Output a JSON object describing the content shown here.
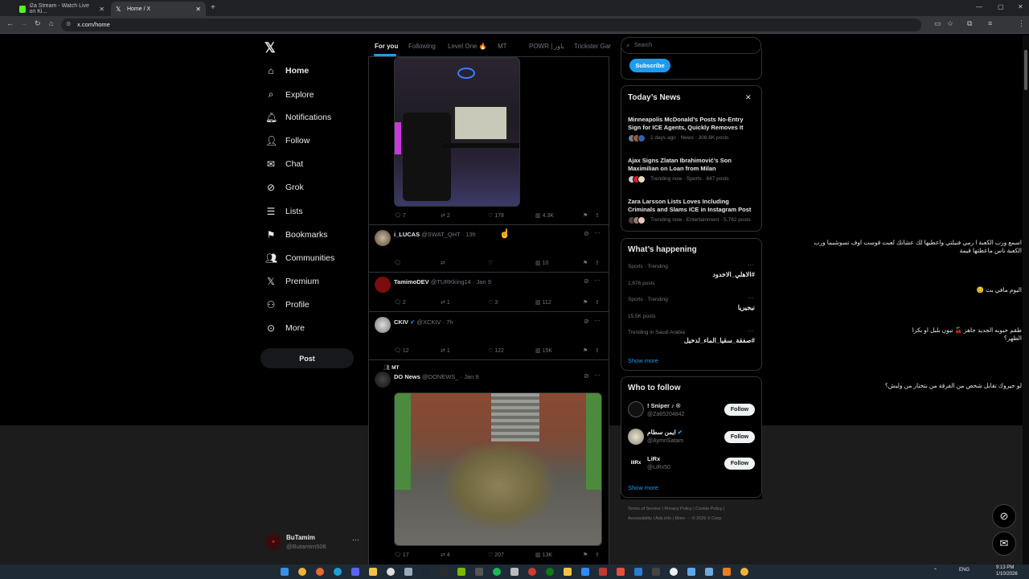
{
  "browser": {
    "tabs": [
      {
        "title": "i2a Stream - Watch Live on Ki...",
        "favicon_color": "#53fc18"
      },
      {
        "title": "Home / X",
        "favicon_color": "#ffffff"
      }
    ],
    "url": "x.com/home"
  },
  "sidebar": {
    "logo": "𝕏",
    "items": [
      {
        "label": "Home",
        "icon": "home-icon",
        "glyph": "⌂"
      },
      {
        "label": "Explore",
        "icon": "search-icon",
        "glyph": "⌕"
      },
      {
        "label": "Notifications",
        "icon": "bell-icon",
        "glyph": "🔔︎"
      },
      {
        "label": "Follow",
        "icon": "person-add-icon",
        "glyph": "👤︎"
      },
      {
        "label": "Chat",
        "icon": "envelope-icon",
        "glyph": "✉"
      },
      {
        "label": "Grok",
        "icon": "grok-icon",
        "glyph": "⊘"
      },
      {
        "label": "Lists",
        "icon": "list-icon",
        "glyph": "☰"
      },
      {
        "label": "Bookmarks",
        "icon": "bookmark-icon",
        "glyph": "⚑"
      },
      {
        "label": "Communities",
        "icon": "communities-icon",
        "glyph": "👥︎"
      },
      {
        "label": "Premium",
        "icon": "x-premium-icon",
        "glyph": "𝕏"
      },
      {
        "label": "Profile",
        "icon": "profile-icon",
        "glyph": "⚇"
      },
      {
        "label": "More",
        "icon": "more-circle-icon",
        "glyph": "⊙"
      }
    ],
    "post_label": "Post",
    "account": {
      "name": "BuTamim",
      "handle": "@Butamim506",
      "more": "···"
    }
  },
  "timeline": {
    "tabs": [
      "For you",
      "Following",
      "Level One 🔥",
      "MT",
      "POWR | باور",
      "Trickster Gar"
    ],
    "tweets": [
      {
        "actions": {
          "replies": "7",
          "reposts": "2",
          "likes": "178",
          "views": "4.3K"
        }
      },
      {
        "name": "i_LUCAS",
        "handle": "@SWAT_QHT",
        "time": "· 13h",
        "text": "اسمع ورب الكعبة ا رمي فنيلتي واعطيها لك عشانك لعبت قوست اوف تسوشيما ورب الكعبة ناس ماعطتها قيمة",
        "actions": {
          "replies": "",
          "reposts": "",
          "likes": "",
          "views": "10"
        }
      },
      {
        "name": "TamimoDEV",
        "handle": "@TURKking14",
        "time": "· Jan 9",
        "text": "اليوم مافي بث 😊",
        "actions": {
          "replies": "2",
          "reposts": "1",
          "likes": "3",
          "views": "112"
        }
      },
      {
        "name": "CKIV",
        "handle": "@XCKIV",
        "time": "· 7h",
        "text": "طقم حبوبه الجديد جاهز 🍒 تبون بلبل او بكرا الظهر؟",
        "actions": {
          "replies": "12",
          "reposts": "1",
          "likes": "122",
          "views": "15K"
        }
      },
      {
        "community": "MT",
        "name": "DO News",
        "handle": "@DONEWS_",
        "time": "· Jan 9",
        "text": "لو حيروك تقابل شخص من الفرقة من بتختار من وليش؟",
        "actions": {
          "replies": "17",
          "reposts": "4",
          "likes": "207",
          "views": "13K"
        }
      }
    ]
  },
  "right": {
    "search_placeholder": "Search",
    "subscribe_label": "Subscribe",
    "news_title": "Today’s News",
    "news": [
      {
        "headline": "Minneapolis McDonald’s Posts No-Entry Sign for ICE Agents, Quickly Removes It",
        "meta": "2 days ago · News · 308.6K posts"
      },
      {
        "headline": "Ajax Signs Zlatan Ibrahimović’s Son Maximilian on Loan from Milan",
        "meta": "Trending now · Sports · 847 posts"
      },
      {
        "headline": "Zara Larsson Lists Loves Including Criminals and Slams ICE in Instagram Post",
        "meta": "Trending now · Entertainment · 5,782 posts"
      }
    ],
    "happening_title": "What’s happening",
    "trends": [
      {
        "context": "Sports · Trending",
        "name": "#الاهلي_الاخدود",
        "posts": "1,676 posts"
      },
      {
        "context": "Sports · Trending",
        "name": "نيجيريا",
        "posts": "15.5K posts"
      },
      {
        "context": "Trending in Saudi Arabia",
        "name": "#صفقة_سقيا_الماء_لدخيل",
        "posts": ""
      }
    ],
    "show_more": "Show more",
    "wtf_title": "Who to follow",
    "follow": [
      {
        "name": "! Sniper ♪ ®",
        "handle": "@Za65204842",
        "button": "Follow"
      },
      {
        "name": "ايمن سطام",
        "handle": "@AymnSatam",
        "button": "Follow"
      },
      {
        "name": "LiRx",
        "handle": "@LiRx50",
        "button": "Follow"
      }
    ],
    "footer1": "Terms of Service  |  Privacy Policy  |  Cookie Policy  |",
    "footer2": "Accessibility  |  Ads info  |  More ···  © 2026 X Corp."
  },
  "system": {
    "time": "9:13 PM",
    "date": "1/10/2026",
    "lang": "ENG"
  }
}
